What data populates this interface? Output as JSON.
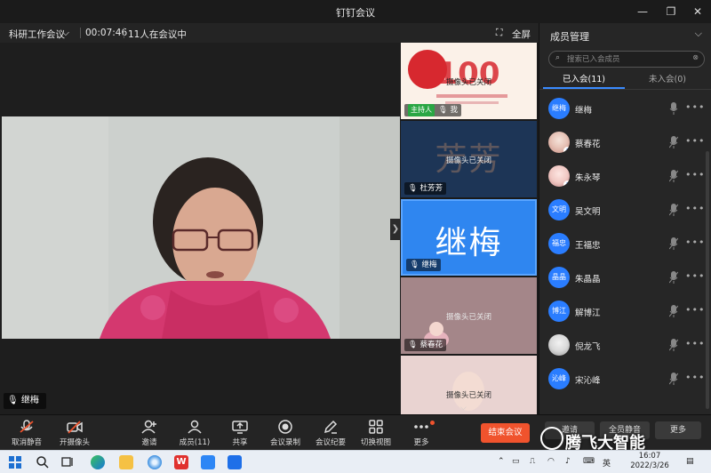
{
  "window": {
    "title": "钉钉会议",
    "controls": [
      "minimize-icon",
      "restore-icon",
      "close-icon"
    ]
  },
  "meeting": {
    "name": "科研工作会议",
    "duration": "00:07:46",
    "count_text": "11人在会议中",
    "fullscreen_label": "全屏"
  },
  "stage": {
    "speaker_name": "继梅"
  },
  "thumbnails": [
    {
      "name": "我",
      "host_tag": "主持人",
      "status": "摄像头已关闭",
      "background": "100-anniversary-poster"
    },
    {
      "name": "杜芳芳",
      "status": "摄像头已关闭",
      "big_text": "芳芳"
    },
    {
      "name": "继梅",
      "big_text": "继梅",
      "active": true
    },
    {
      "name": "蔡春花",
      "status": "摄像头已关闭"
    },
    {
      "status": "摄像头已关闭"
    }
  ],
  "panel": {
    "title": "成员管理",
    "search_placeholder": "搜索已入会成员",
    "tab_joined": "已入会(11)",
    "tab_not_joined": "未入会(0)",
    "members": [
      {
        "name": "继梅",
        "avatar_text": "继梅",
        "avatar": "text"
      },
      {
        "name": "蔡春花",
        "avatar": "photo"
      },
      {
        "name": "朱永琴",
        "avatar": "photo"
      },
      {
        "name": "吴文明",
        "avatar_text": "文明",
        "avatar": "text"
      },
      {
        "name": "王福忠",
        "avatar_text": "福忠",
        "avatar": "text"
      },
      {
        "name": "朱晶晶",
        "avatar_text": "晶晶",
        "avatar": "text"
      },
      {
        "name": "解博江",
        "avatar_text": "博江",
        "avatar": "text"
      },
      {
        "name": "倪龙飞",
        "avatar": "photo"
      },
      {
        "name": "宋沁峰",
        "avatar_text": "沁峰",
        "avatar": "text"
      }
    ],
    "invite_label": "邀请",
    "mute_all_label": "全员静音",
    "more_label": "更多"
  },
  "toolbar": {
    "unmute": "取消静音",
    "camera_on": "开摄像头",
    "invite": "邀请",
    "members": "成员(11)",
    "share": "共享",
    "record": "会议录制",
    "minutes": "会议纪要",
    "switch_view": "切换视图",
    "more": "更多",
    "end_meeting": "结束会议"
  },
  "watermark": "腾飞大智能",
  "taskbar": {
    "ime": "英",
    "time": "16:07",
    "date": "2022/3/26"
  }
}
